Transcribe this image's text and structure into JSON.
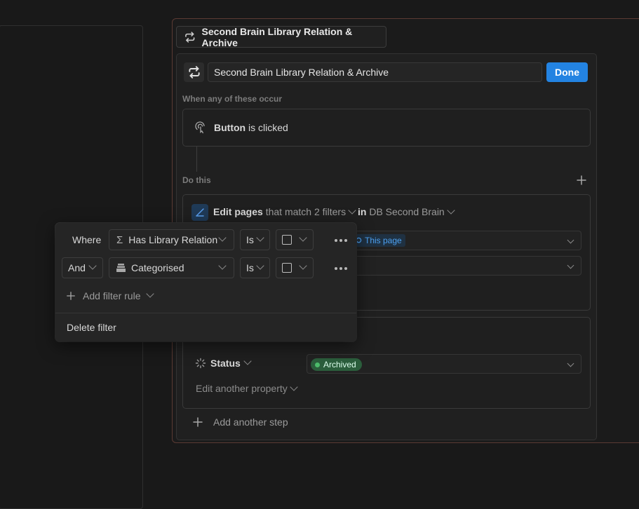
{
  "button_title": "Second Brain Library Relation & Archive",
  "name_input_value": "Second Brain Library Relation & Archive",
  "done_label": "Done",
  "trigger": {
    "section_label": "When any of these occur",
    "subject": "Button",
    "verb": "is clicked"
  },
  "actions": {
    "section_label": "Do this",
    "step1": {
      "verb": "Edit",
      "object": "pages",
      "middle": "that match",
      "filter_count": "2 filters",
      "in_word": "in",
      "database": "DB Second Brain",
      "this_page": "This page"
    },
    "step2": {
      "property": "Status",
      "value": "Archived",
      "edit_another": "Edit another property"
    },
    "add_step": "Add another step"
  },
  "filter_popover": {
    "rows": [
      {
        "conjunction": "Where",
        "property": "Has Library Relation",
        "operator": "Is"
      },
      {
        "conjunction": "And",
        "property": "Categorised",
        "operator": "Is"
      }
    ],
    "add_rule": "Add filter rule",
    "delete": "Delete filter"
  },
  "colors": {
    "accent": "#2383e2",
    "archived": "#2b5e3c",
    "card_border": "#5b3a33"
  }
}
